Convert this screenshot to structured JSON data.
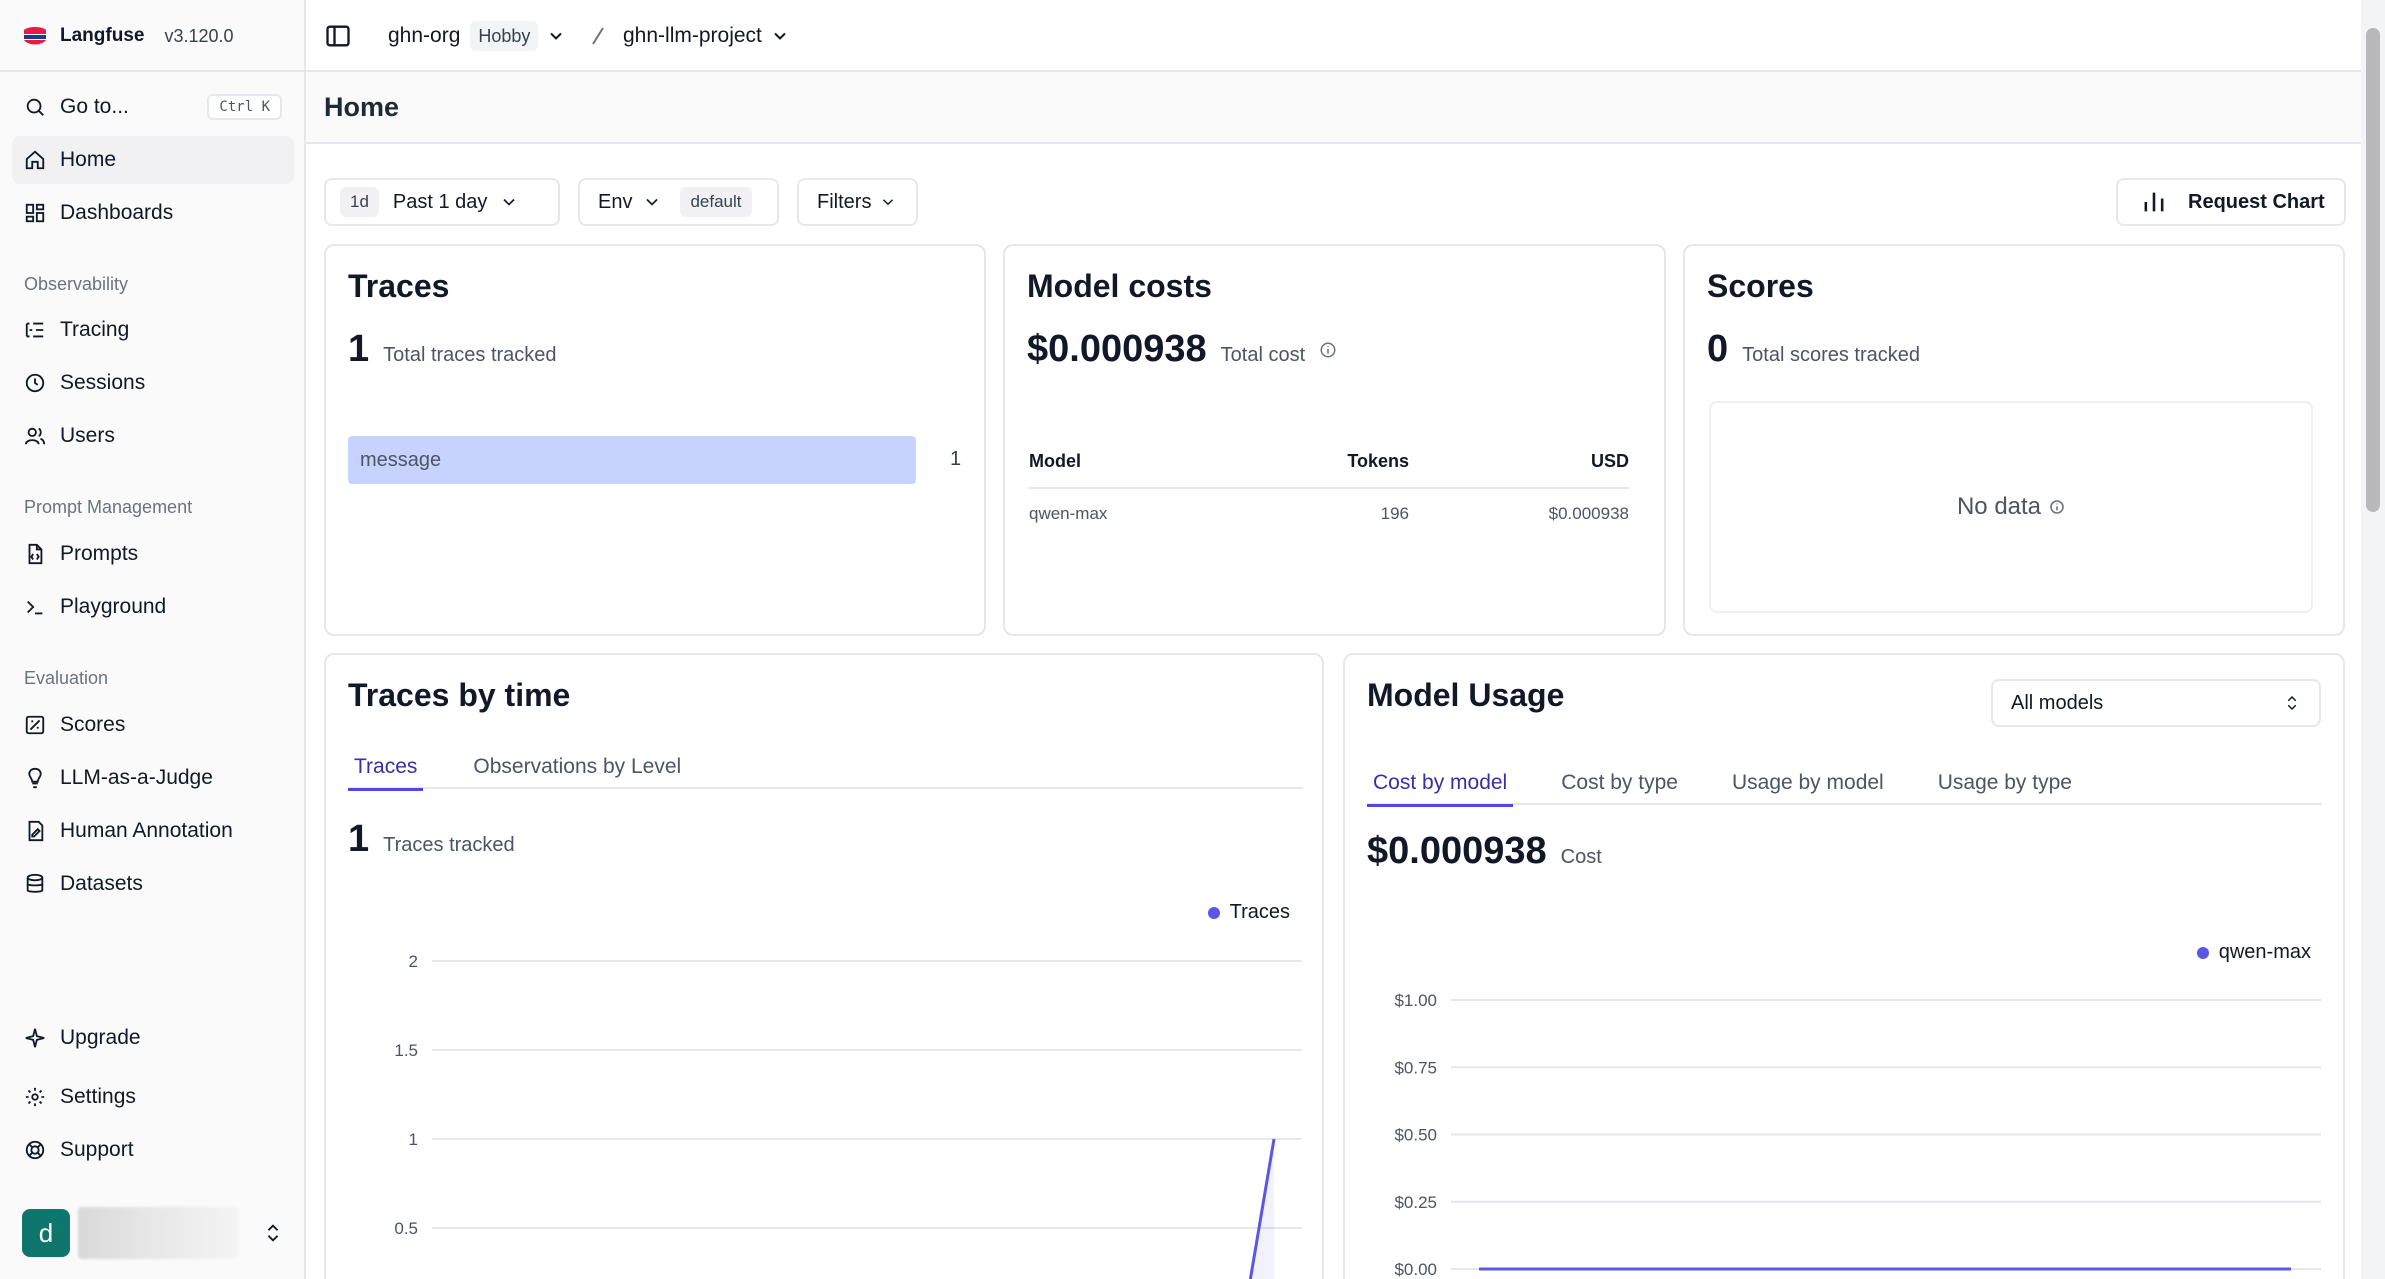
{
  "app": {
    "name": "Langfuse",
    "version": "v3.120.0"
  },
  "sidebar": {
    "goto": {
      "label": "Go to...",
      "shortcut": "Ctrl K"
    },
    "items_main": [
      {
        "label": "Home",
        "icon": "home-icon"
      },
      {
        "label": "Dashboards",
        "icon": "dashboard-icon"
      }
    ],
    "sections": {
      "observability": "Observability",
      "prompt_management": "Prompt Management",
      "evaluation": "Evaluation"
    },
    "observability_items": [
      {
        "label": "Tracing",
        "icon": "tracing-icon"
      },
      {
        "label": "Sessions",
        "icon": "clock-icon"
      },
      {
        "label": "Users",
        "icon": "users-icon"
      }
    ],
    "prompt_items": [
      {
        "label": "Prompts",
        "icon": "file-code-icon"
      },
      {
        "label": "Playground",
        "icon": "terminal-icon"
      }
    ],
    "evaluation_items": [
      {
        "label": "Scores",
        "icon": "score-icon"
      },
      {
        "label": "LLM-as-a-Judge",
        "icon": "lightbulb-icon"
      },
      {
        "label": "Human Annotation",
        "icon": "annotation-icon"
      },
      {
        "label": "Datasets",
        "icon": "database-icon"
      }
    ],
    "bottom_items": [
      {
        "label": "Upgrade",
        "icon": "sparkle-icon"
      },
      {
        "label": "Settings",
        "icon": "gear-icon"
      },
      {
        "label": "Support",
        "icon": "lifebuoy-icon"
      }
    ],
    "user": {
      "avatar_letter": "d"
    }
  },
  "topbar": {
    "org": "ghn-org",
    "plan": "Hobby",
    "project": "ghn-llm-project"
  },
  "page": {
    "title": "Home"
  },
  "filters": {
    "range_short": "1d",
    "range_label": "Past 1 day",
    "env_label": "Env",
    "env_value": "default",
    "filters_label": "Filters",
    "request_chart": "Request Chart"
  },
  "traces_card": {
    "title": "Traces",
    "count": "1",
    "count_label": "Total traces tracked",
    "bar": {
      "name": "message",
      "value": "1"
    }
  },
  "model_costs_card": {
    "title": "Model costs",
    "total": "$0.000938",
    "total_label": "Total cost",
    "headers": [
      "Model",
      "Tokens",
      "USD"
    ],
    "rows": [
      [
        "qwen-max",
        "196",
        "$0.000938"
      ]
    ]
  },
  "scores_card": {
    "title": "Scores",
    "count": "0",
    "count_label": "Total scores tracked",
    "empty": "No data"
  },
  "traces_by_time": {
    "title": "Traces by time",
    "tabs": [
      "Traces",
      "Observations by Level"
    ],
    "count": "1",
    "count_label": "Traces tracked",
    "legend": "Traces",
    "y_ticks": [
      "2",
      "1.5",
      "1",
      "0.5"
    ]
  },
  "model_usage": {
    "title": "Model Usage",
    "select": "All models",
    "tabs": [
      "Cost by model",
      "Cost by type",
      "Usage by model",
      "Usage by type"
    ],
    "total": "$0.000938",
    "total_label": "Cost",
    "legend": "qwen-max",
    "y_ticks": [
      "$1.00",
      "$0.75",
      "$0.50",
      "$0.25",
      "$0.00"
    ]
  },
  "colors": {
    "accent": "#4f46e5",
    "bar_fill": "#c7d2fe",
    "series": "#5b57e6"
  },
  "chart_data": [
    {
      "type": "line",
      "title": "Traces by time",
      "ylim": [
        0,
        2
      ],
      "series": [
        {
          "name": "Traces",
          "values": [
            0,
            1
          ]
        }
      ]
    },
    {
      "type": "line",
      "title": "Model Usage",
      "ylim": [
        0,
        1
      ],
      "series": [
        {
          "name": "qwen-max",
          "values": [
            0,
            0
          ]
        }
      ]
    }
  ]
}
